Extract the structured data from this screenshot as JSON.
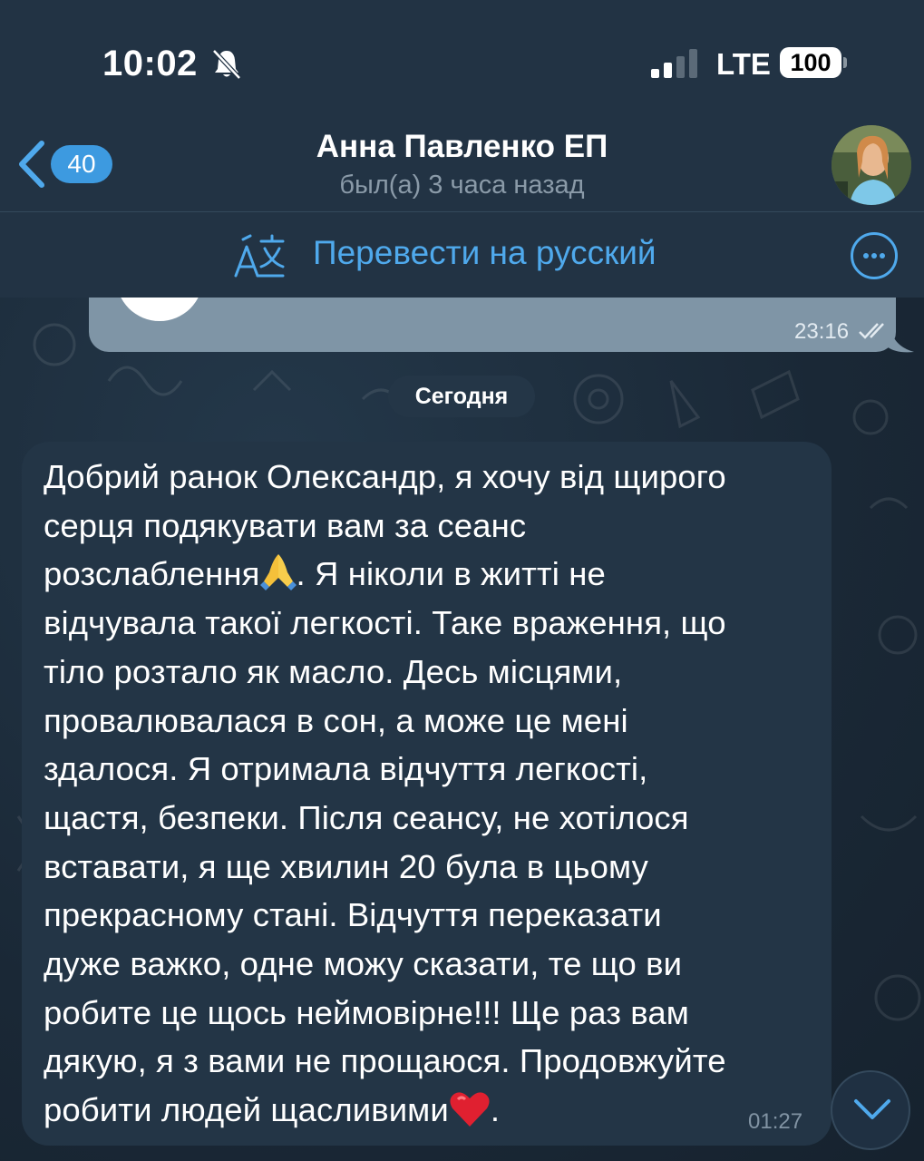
{
  "status_bar": {
    "time": "10:02",
    "network": "LTE",
    "battery": "100",
    "icons": [
      "bell-slash-icon",
      "signal-icon"
    ]
  },
  "nav": {
    "unread_count": "40",
    "contact_name": "Анна Павленко ЕП",
    "contact_status": "был(а) 3 часа назад",
    "icons": [
      "chevron-left-icon",
      "avatar"
    ]
  },
  "translate_bar": {
    "label": "Перевести на русский",
    "icons": [
      "translate-icon",
      "more-icon"
    ]
  },
  "messages": {
    "outgoing_time": "23:16",
    "date_separator": "Сегодня",
    "incoming": {
      "lines": [
        "Добрий ранок Олександр, я хочу від щирого",
        "серця подякувати вам за сеанс",
        "розслаблення",
        ". Я ніколи в житті не",
        "відчувала такої легкості. Таке враження, що",
        "тіло розтало як масло. Десь місцями,",
        "провалювалася в сон, а може це мені",
        "здалося. Я отримала відчуття легкості,",
        "щастя, безпеки. Після сеансу, не хотілося",
        "вставати, я ще хвилин 20 була в цьому",
        "прекрасному стані. Відчуття переказати",
        "дуже важко, одне можу сказати, те що ви",
        "робите це щось неймовірне!!! Ще раз вам",
        "дякую, я з вами не прощаюся. Продовжуйте",
        "робити людей щасливими",
        "."
      ],
      "time": "01:27",
      "emojis": [
        "folded-hands",
        "red-heart"
      ]
    }
  },
  "colors": {
    "accent": "#4fa9ec",
    "badge": "#3d9ae0",
    "outgoing_bubble": "#7f95a6",
    "incoming_bubble": "#233546",
    "header": "#223344"
  }
}
